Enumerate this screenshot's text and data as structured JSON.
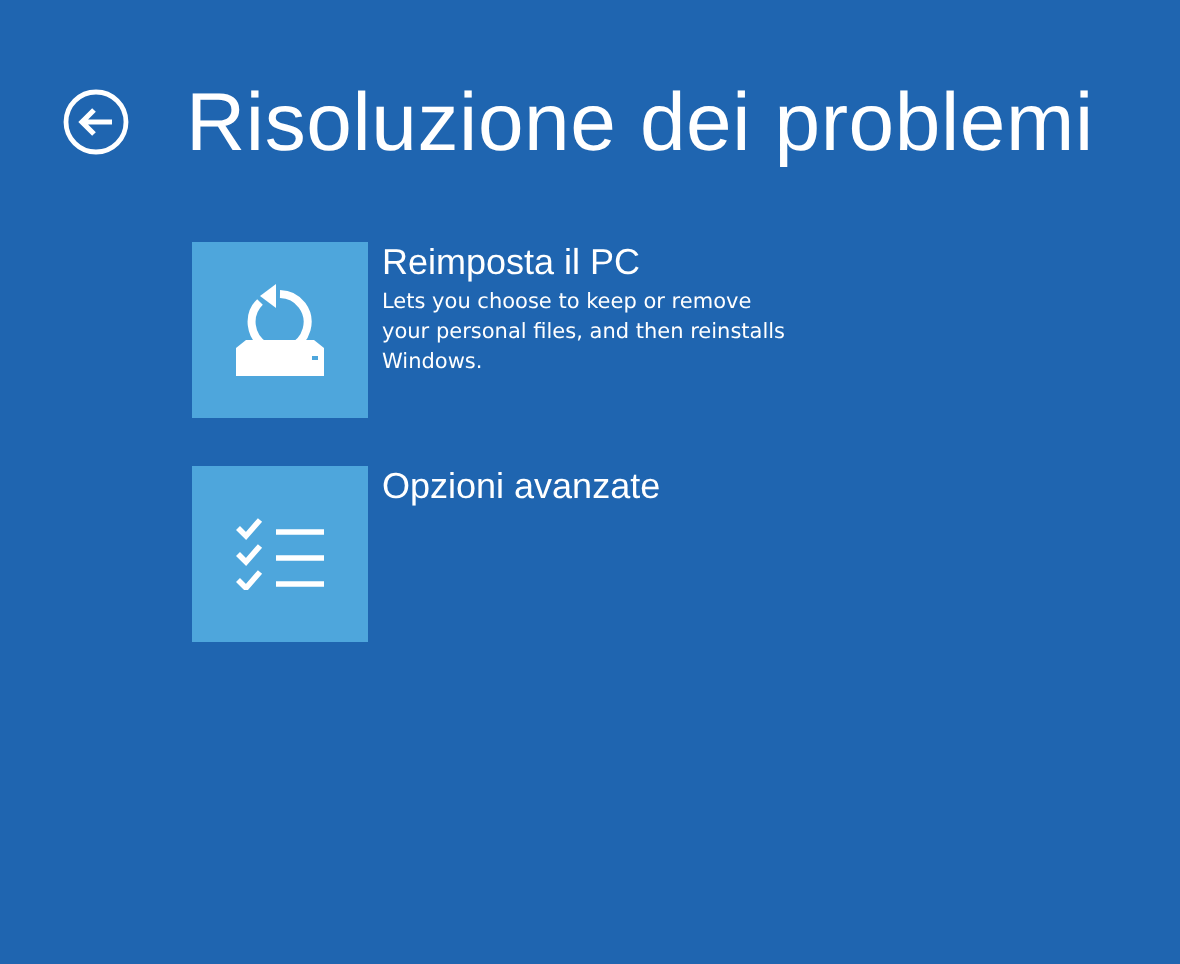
{
  "title": "Risoluzione dei problemi",
  "options": [
    {
      "kind": "reset",
      "title": "Reimposta il PC",
      "description": "Lets you choose to keep or remove your personal files, and then reinstalls Windows."
    },
    {
      "kind": "advanced",
      "title": "Opzioni avanzate"
    }
  ]
}
